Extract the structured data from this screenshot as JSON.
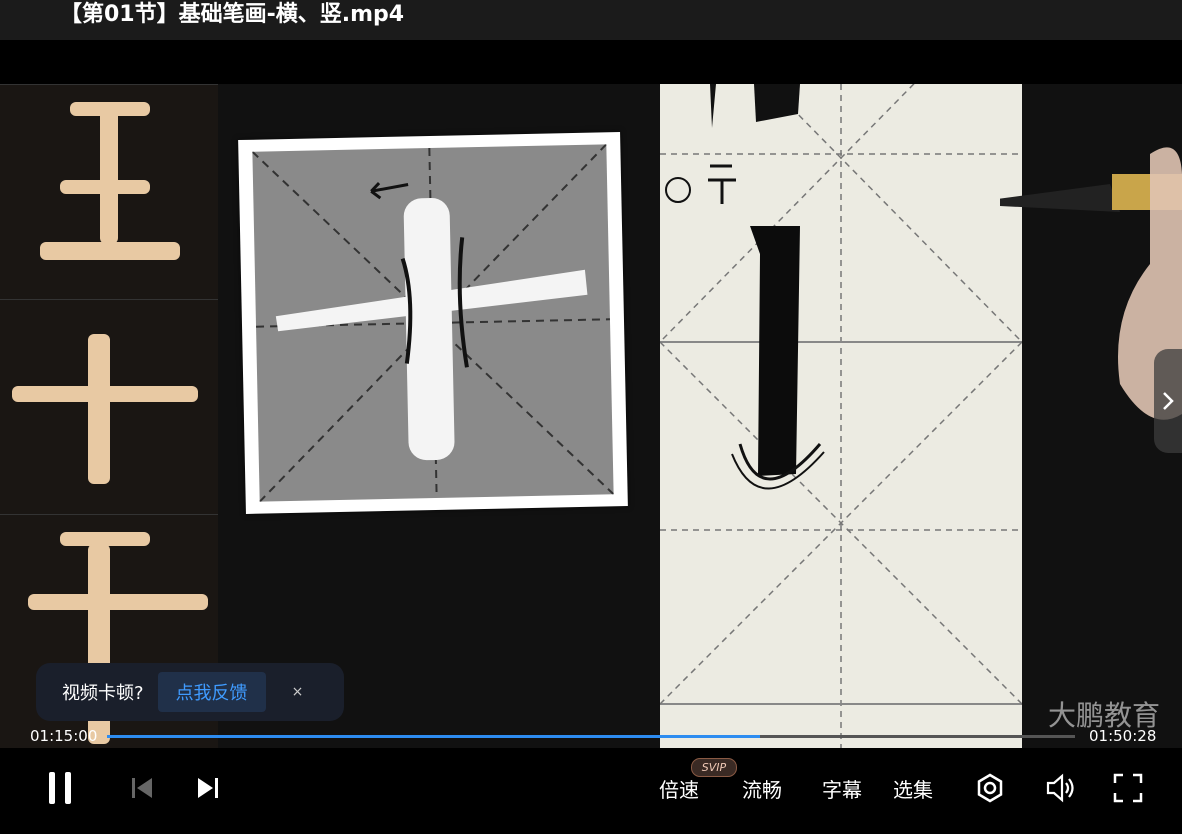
{
  "header": {
    "title": "【第01节】基础笔画-横、竖.mp4"
  },
  "video": {
    "watermark": "大鹏教育"
  },
  "feedback_toast": {
    "question": "视频卡顿?",
    "action_label": "点我反馈",
    "close_glyph": "×"
  },
  "progress": {
    "current_time": "01:15:00",
    "total_time": "01:50:28",
    "fraction": 0.675,
    "color": "#2d8cf0"
  },
  "controls": {
    "speed_label": "倍速",
    "speed_badge": "SVIP",
    "quality_label": "流畅",
    "subtitle_label": "字幕",
    "episodes_label": "选集",
    "icons": [
      "pause-icon",
      "previous-icon",
      "next-icon",
      "settings-icon",
      "volume-icon",
      "fullscreen-icon"
    ]
  }
}
